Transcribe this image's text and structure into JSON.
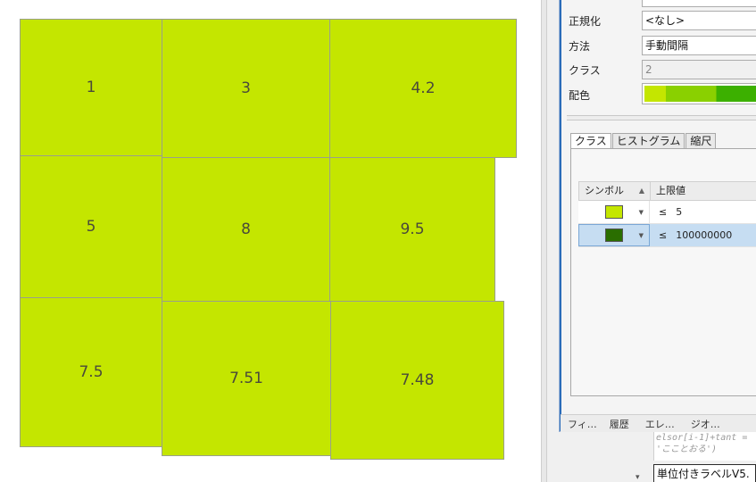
{
  "map": {
    "polygons": [
      {
        "label": "1"
      },
      {
        "label": "3"
      },
      {
        "label": "4.2"
      },
      {
        "label": "5"
      },
      {
        "label": "8"
      },
      {
        "label": "9.5"
      },
      {
        "label": "7.5"
      },
      {
        "label": "7.51"
      },
      {
        "label": "7.48"
      }
    ],
    "fill_color": "#c4e600"
  },
  "symbology": {
    "normalization_label": "正規化",
    "normalization_value": "<なし>",
    "method_label": "方法",
    "method_value": "手動間隔",
    "classes_label": "クラス",
    "classes_value": "2",
    "color_scheme_label": "配色",
    "tabs": [
      {
        "label": "クラス",
        "active": true
      },
      {
        "label": "ヒストグラム",
        "active": false
      },
      {
        "label": "縮尺",
        "active": false
      }
    ],
    "table": {
      "col_symbol": "シンボル",
      "col_upper": "上限値",
      "rows": [
        {
          "le": "≤",
          "value": "5",
          "color": "#c4e600",
          "selected": false
        },
        {
          "le": "≤",
          "value": "100000000",
          "color": "#2a6e00",
          "selected": true
        }
      ]
    }
  },
  "dock": {
    "tabs": [
      "フィ…",
      "履歴",
      "エレ…",
      "ジオ…"
    ]
  },
  "code": {
    "line1": "elsor[i-1]+tant =",
    "line2": "'こことおる')"
  },
  "label_field": "単位付きラベルV5."
}
